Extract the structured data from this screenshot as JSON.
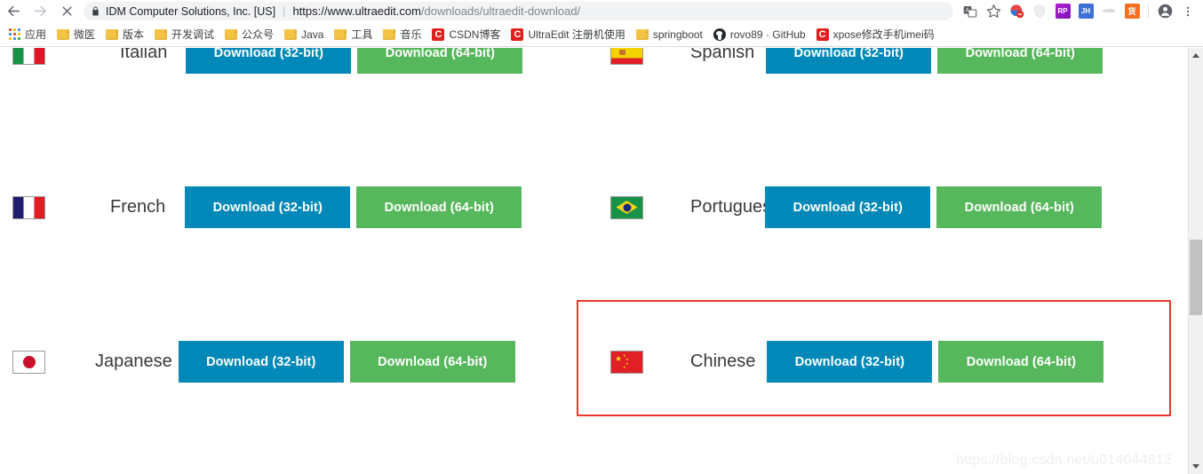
{
  "browser": {
    "back_label": "Back",
    "forward_label": "Forward",
    "stop_label": "Stop",
    "security_label": "IDM Computer Solutions, Inc. [US]",
    "url_origin": "https://www.ultraedit.com",
    "url_path": "/downloads/ultraedit-download/",
    "omni_divider": "|",
    "toolbar_icons": [
      {
        "name": "translate-icon",
        "glyph": "文",
        "bg": "#5f6368"
      },
      {
        "name": "bookmark-star-icon",
        "glyph": "☆",
        "bg": ""
      },
      {
        "name": "adblock-extension-icon",
        "glyph": "",
        "bg": "#2a7ae2"
      },
      {
        "name": "shield-extension-icon",
        "glyph": "",
        "bg": "#e8eaed"
      },
      {
        "name": "rp-extension-icon",
        "glyph": "RP",
        "bg": "#8a1fbd"
      },
      {
        "name": "jh-extension-icon",
        "glyph": "JH",
        "bg": "#3d6fd4"
      },
      {
        "name": "cmtv-extension-icon",
        "glyph": "cmtv",
        "bg": "#ffffff"
      },
      {
        "name": "orange-extension-icon",
        "glyph": "货",
        "bg": "#f37021"
      },
      {
        "name": "profile-avatar-icon",
        "glyph": "",
        "bg": "#5f6368"
      },
      {
        "name": "chrome-menu-icon",
        "glyph": "⋮",
        "bg": ""
      }
    ]
  },
  "bookmarks": [
    {
      "label": "应用",
      "icon": "apps-grid-icon"
    },
    {
      "label": "微医",
      "icon": "folder-icon"
    },
    {
      "label": "版本",
      "icon": "folder-icon"
    },
    {
      "label": "开发调试",
      "icon": "folder-icon"
    },
    {
      "label": "公众号",
      "icon": "folder-icon"
    },
    {
      "label": "Java",
      "icon": "folder-icon"
    },
    {
      "label": "工具",
      "icon": "folder-icon"
    },
    {
      "label": "音乐",
      "icon": "folder-icon"
    },
    {
      "label": "CSDN博客",
      "icon": "csdn-icon"
    },
    {
      "label": "UltraEdit 注册机使用",
      "icon": "csdn-icon"
    },
    {
      "label": "springboot",
      "icon": "folder-icon"
    },
    {
      "label": "rovo89 · GitHub",
      "icon": "github-icon"
    },
    {
      "label": "xpose修改手机imei码",
      "icon": "csdn-icon"
    }
  ],
  "page": {
    "button_32_label": "Download (32-bit)",
    "button_64_label": "Download (64-bit)",
    "colors": {
      "button_32_bg": "#0089b8",
      "button_64_bg": "#57b75c",
      "highlight_border": "#f0352c"
    },
    "languages": [
      {
        "name": "Italian",
        "flag": "italy-flag"
      },
      {
        "name": "Spanish",
        "flag": "spain-flag"
      },
      {
        "name": "French",
        "flag": "france-flag"
      },
      {
        "name": "Portuguese",
        "flag": "brazil-flag"
      },
      {
        "name": "Japanese",
        "flag": "japan-flag"
      },
      {
        "name": "Chinese",
        "flag": "china-flag"
      }
    ],
    "watermark": "https://blog.csdn.net/u014044812"
  },
  "scrollbar": {
    "up_arrow": "▲",
    "down_arrow": "▼"
  }
}
